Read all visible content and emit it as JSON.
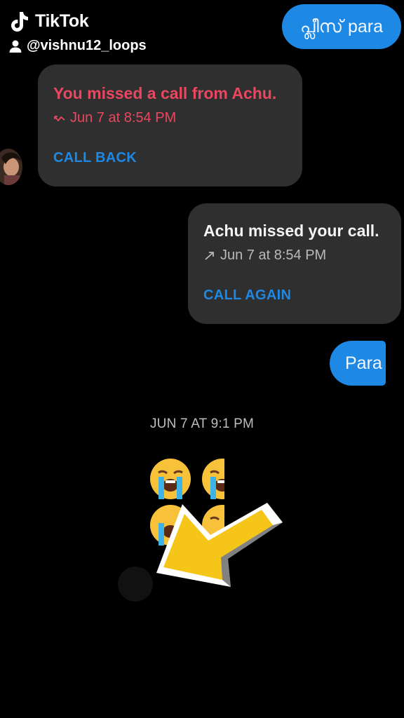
{
  "watermark": {
    "brand": "TikTok",
    "username": "@vishnu12_loops",
    "logo_icon": "tiktok-note-icon",
    "user_icon": "person-icon"
  },
  "messages": {
    "top_bubble": "പ്ലീസ് para",
    "missed_call_card": {
      "title": "You missed a call from Achu.",
      "time": "Jun 7 at 8:54 PM",
      "action": "CALL BACK",
      "icon": "missed-call-icon"
    },
    "outgoing_call_card": {
      "title": "Achu missed your call.",
      "time": "Jun 7 at 8:54 PM",
      "action": "CALL AGAIN",
      "icon": "outgoing-call-icon"
    },
    "para_bubble": "Para",
    "timestamp": "JUN 7 AT 9:1  PM",
    "emoji_icon": "loudly-crying-face-emoji"
  },
  "colors": {
    "background": "#000000",
    "card": "#2f2f2f",
    "accent_blue": "#1e88e5",
    "missed_red": "#e8475f",
    "arrow_yellow": "#f5c518"
  }
}
